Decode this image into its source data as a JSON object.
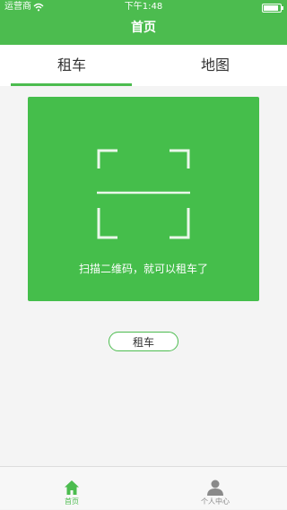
{
  "status_bar": {
    "carrier": "运营商",
    "time": "下午1:48"
  },
  "header": {
    "title": "首页"
  },
  "tabs": [
    {
      "label": "租车",
      "selected": true
    },
    {
      "label": "地图",
      "selected": false
    }
  ],
  "scanner": {
    "hint": "扫描二维码，就可以租车了",
    "icon": "scan-frame-icon"
  },
  "rent_button": {
    "label": "租车"
  },
  "tabbar": {
    "items": [
      {
        "label": "首页",
        "icon": "home-icon",
        "selected": true
      },
      {
        "label": "个人中心",
        "icon": "person-icon",
        "selected": false
      }
    ]
  },
  "colors": {
    "accent": "#4cbc4f",
    "panel": "#45be4b",
    "background": "#f4f4f4"
  }
}
